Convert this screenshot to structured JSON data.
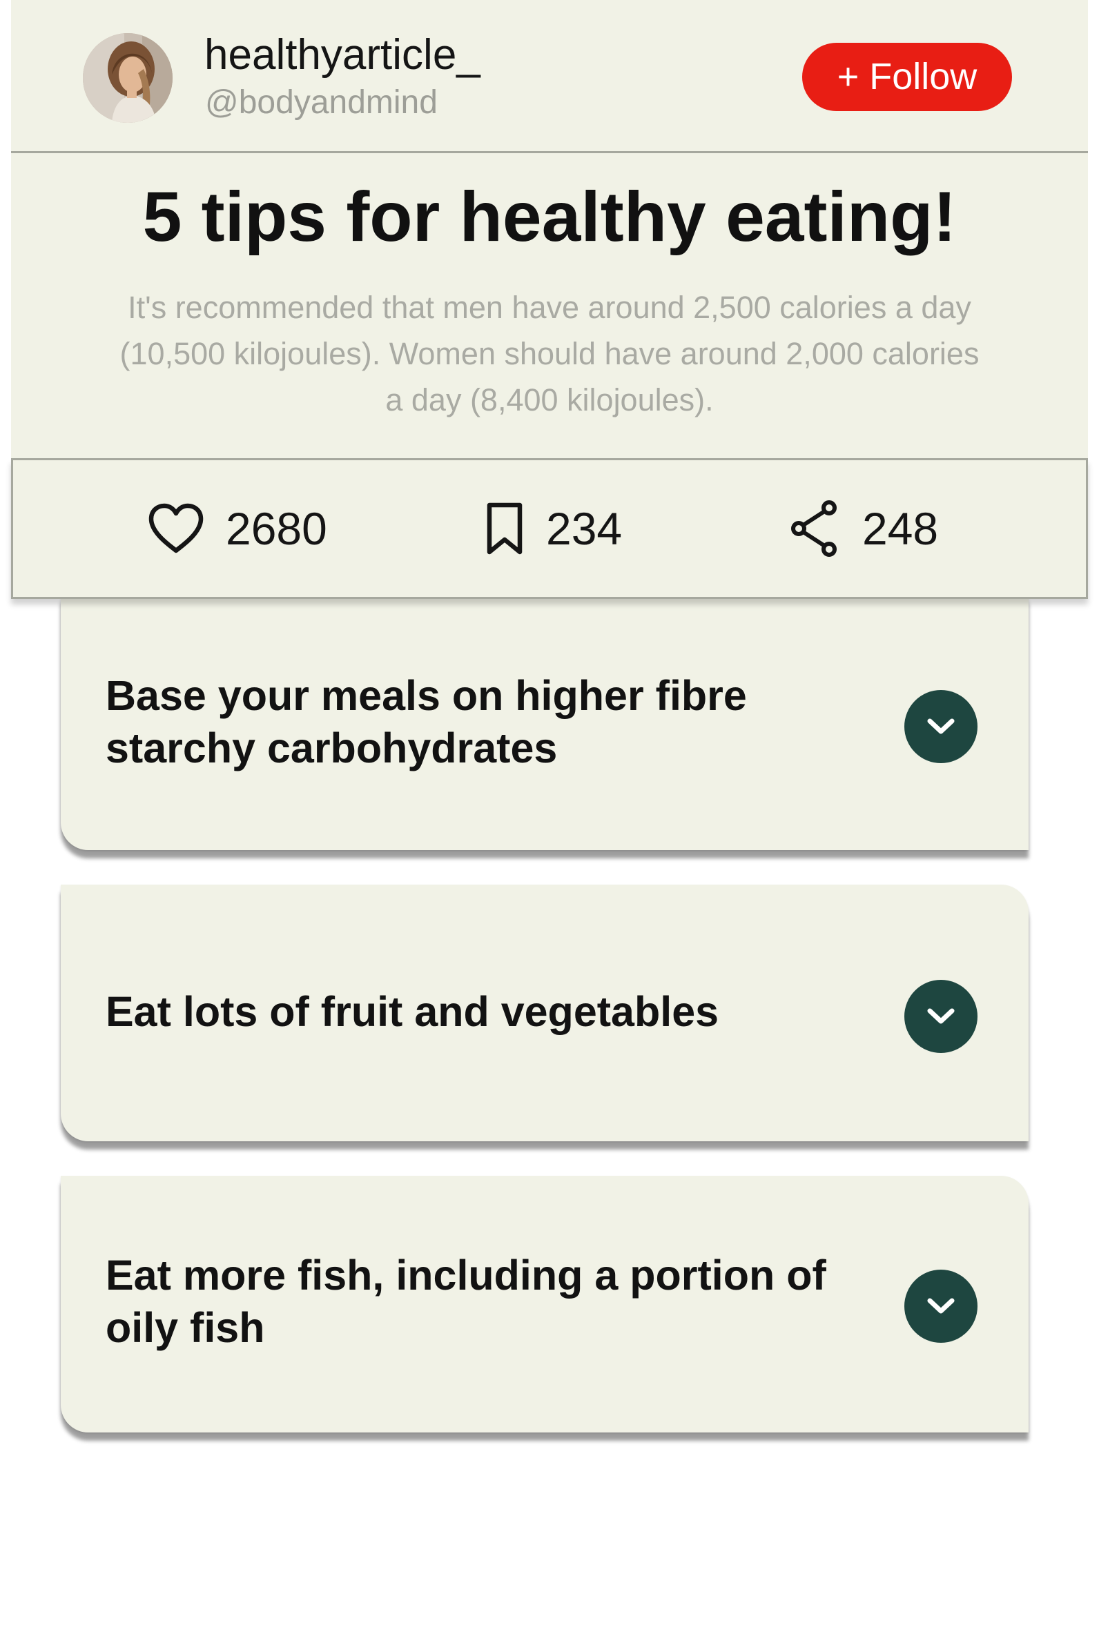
{
  "author": {
    "username": "healthyarticle_",
    "handle": "@bodyandmind",
    "follow_label": "+ Follow"
  },
  "article": {
    "title": "5 tips for healthy eating!",
    "summary": "It's recommended that men have around 2,500 calories a day (10,500 kilojoules). Women should have around 2,000 calories a day (8,400 kilojoules)."
  },
  "stats": {
    "likes": "2680",
    "saves": "234",
    "shares": "248"
  },
  "icons": {
    "likes": "heart-icon",
    "saves": "bookmark-icon",
    "shares": "share-icon",
    "expand": "chevron-down-icon"
  },
  "tips": [
    {
      "title": "Base your meals on higher fibre starchy carbohydrates"
    },
    {
      "title": "Eat lots of fruit and vegetables"
    },
    {
      "title": "Eat more fish, including a portion of oily fish"
    }
  ],
  "colors": {
    "panel_background": "#f1f2e6",
    "follow_button": "#e81e14",
    "chevron_button": "#1e4640",
    "muted_text": "#a9aaa3",
    "divider": "#a6a89e"
  }
}
